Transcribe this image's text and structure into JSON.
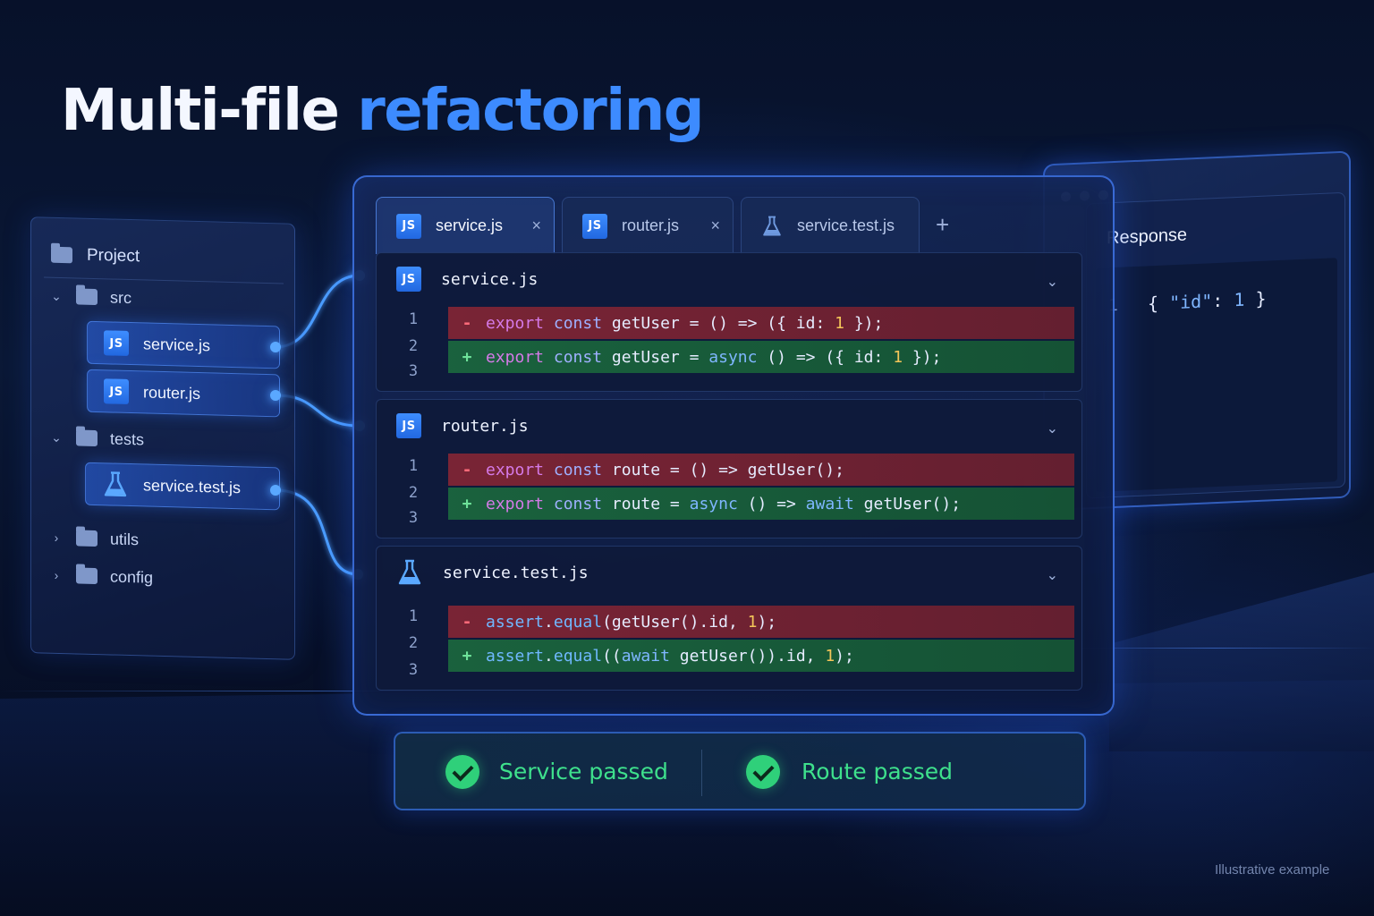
{
  "headline": {
    "part1": "Multi-file",
    "part2": "refactoring"
  },
  "colors": {
    "accent": "#3d8bff",
    "deletion": "#8c2634",
    "addition": "#1c6e3e",
    "success": "#2fd07a"
  },
  "explorer": {
    "root": {
      "label": "Project",
      "icon": "folder-icon"
    },
    "items": [
      {
        "type": "folder",
        "label": "src",
        "expanded": true
      },
      {
        "type": "file",
        "label": "service.js",
        "icon": "js-icon",
        "badge": "JS",
        "selected": true
      },
      {
        "type": "file",
        "label": "router.js",
        "icon": "js-icon",
        "badge": "JS",
        "selected": true
      },
      {
        "type": "folder",
        "label": "tests",
        "expanded": true
      },
      {
        "type": "file",
        "label": "service.test.js",
        "icon": "flask-icon",
        "selected": true
      },
      {
        "type": "folder",
        "label": "utils",
        "expanded": false
      },
      {
        "type": "folder",
        "label": "config",
        "expanded": false
      }
    ]
  },
  "editor": {
    "tabs": [
      {
        "label": "service.js",
        "icon": "js-icon",
        "badge": "JS",
        "active": true,
        "close": "×"
      },
      {
        "label": "router.js",
        "icon": "js-icon",
        "badge": "JS",
        "active": false,
        "close": "×"
      },
      {
        "label": "service.test.js",
        "icon": "flask-icon",
        "active": false
      }
    ],
    "add_tab": "+",
    "panels": [
      {
        "file": "service.js",
        "icon": "js-icon",
        "badge": "JS",
        "line_numbers": [
          "1",
          "2",
          "3"
        ],
        "removed": {
          "sign": "-",
          "code": "export const getUser = () => ({ id: 1 });"
        },
        "added": {
          "sign": "+",
          "code": "export const getUser = async () => ({ id: 1 });"
        }
      },
      {
        "file": "router.js",
        "icon": "js-icon",
        "badge": "JS",
        "line_numbers": [
          "1",
          "2",
          "3"
        ],
        "removed": {
          "sign": "-",
          "code": "export const route = () => getUser();"
        },
        "added": {
          "sign": "+",
          "code": "export const route = async () => await getUser();"
        }
      },
      {
        "file": "service.test.js",
        "icon": "flask-icon",
        "line_numbers": [
          "1",
          "2",
          "3"
        ],
        "removed": {
          "sign": "-",
          "code": "assert.equal(getUser().id, 1);"
        },
        "added": {
          "sign": "+",
          "code": "assert.equal((await getUser()).id, 1);"
        }
      }
    ]
  },
  "response": {
    "title": "Response",
    "line_number": "1",
    "json": "{ \"id\": 1 }"
  },
  "status": [
    {
      "label": "Service passed",
      "icon": "check-circle-icon"
    },
    {
      "label": "Route passed",
      "icon": "check-circle-icon"
    }
  ],
  "footnote": "Illustrative example"
}
